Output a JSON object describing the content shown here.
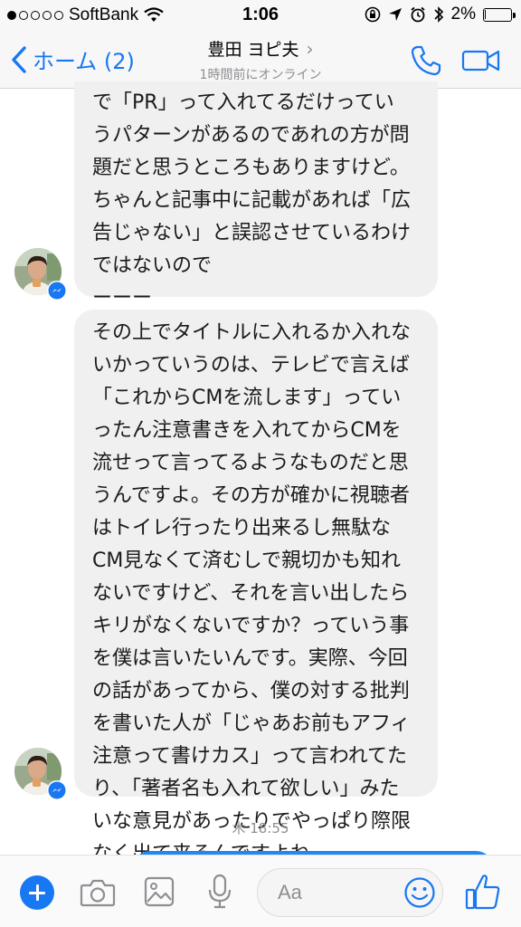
{
  "status": {
    "carrier": "SoftBank",
    "time": "1:06",
    "battery_percent": "2%",
    "battery_level": 0.02
  },
  "nav": {
    "back_label": "ホーム (2)",
    "contact_name": "豊田 ヨピ夫",
    "chevron": "›",
    "presence": "1時間前にオンライン",
    "accent_color": "#1877f2"
  },
  "messages": [
    {
      "lines": [
        "で「PR」って入れてるだけってい",
        "うパターンがあるのであれの方が問",
        "題だと思うところもありますけど。",
        "ちゃんと記事中に記載があれば「広",
        "告じゃない」と誤認させているわけ",
        "ではないので",
        "ーーー"
      ]
    },
    {
      "lines": [
        "その上でタイトルに入れるか入れな",
        "いかっていうのは、テレビで言えば",
        "「これからCMを流します」ってい",
        "ったん注意書きを入れてからCMを",
        "流せって言ってるようなものだと思",
        "うんですよ。その方が確かに視聴者",
        "はトイレ行ったり出来るし無駄な",
        "CM見なくて済むしで親切かも知れ",
        "ないですけど、それを言い出したら",
        "キリがなくないですか？っていう事",
        "を僕は言いたいんです。実際、今回",
        "の話があってから、僕の対する批判",
        "を書いた人が「じゃあお前もアフィ",
        "注意って書けカス」って言われてた",
        "り、「著者名も入れて欲しい」みた",
        "いな意見があったりでやっぱり際限",
        "なく出て来るんですよね。"
      ]
    }
  ],
  "timestamp": "木 18:55",
  "composer": {
    "placeholder": "Aa"
  },
  "icons": {
    "back": "chevron-left-icon",
    "call": "phone-icon",
    "video": "video-camera-icon",
    "add": "plus-icon",
    "camera": "camera-icon",
    "gallery": "gallery-icon",
    "mic": "microphone-icon",
    "emoji": "smiley-icon",
    "like": "thumbs-up-icon"
  }
}
